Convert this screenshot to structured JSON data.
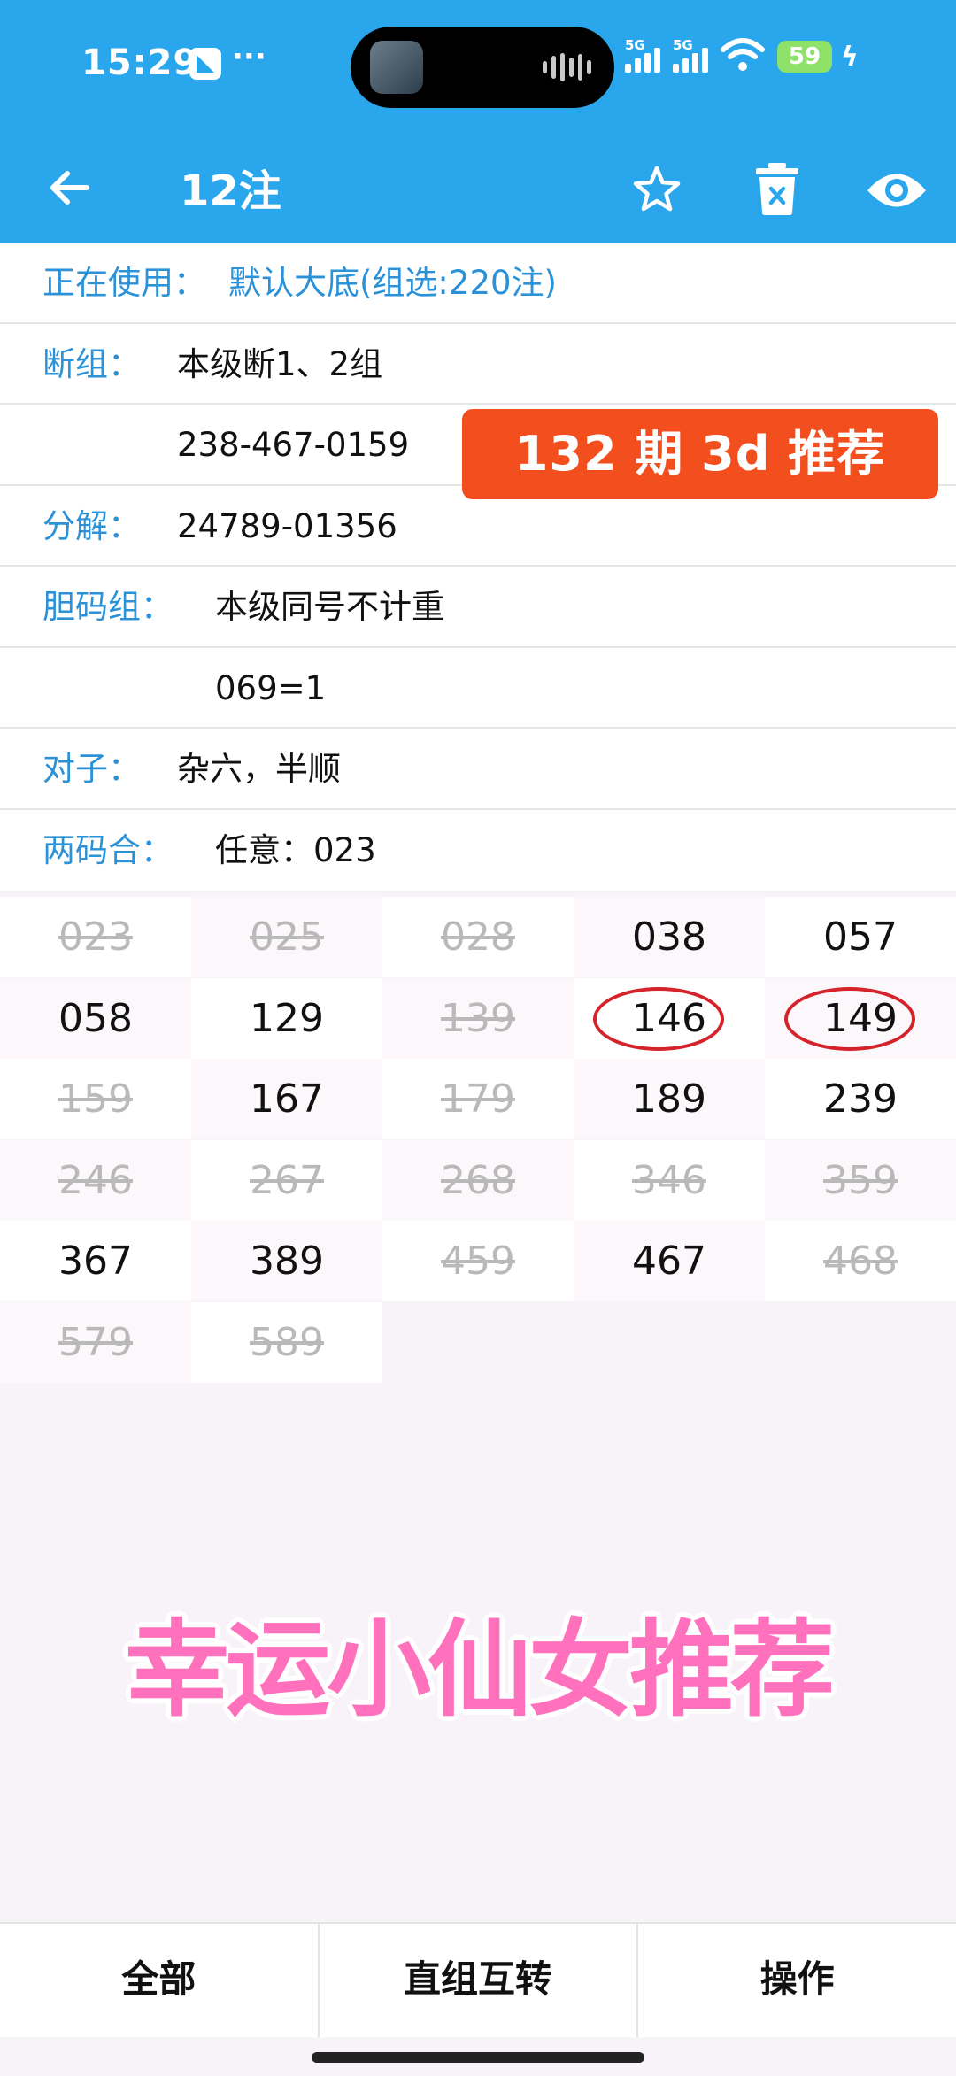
{
  "status_bar": {
    "time": "15:29",
    "dots": "···",
    "signal_1": "5G",
    "signal_2": "5G",
    "battery": "59"
  },
  "app_bar": {
    "title": "12注"
  },
  "info_rows": [
    {
      "label": "正在使用：",
      "value": "默认大底(组选:220注)"
    },
    {
      "label": "断组：",
      "value": "本级断1、2组"
    },
    {
      "label": "",
      "value": "238-467-0159"
    },
    {
      "label": "分解：",
      "value": "24789-01356"
    },
    {
      "label": "胆码组：",
      "value": "本级同号不计重"
    },
    {
      "label": "",
      "value": "069=1"
    },
    {
      "label": "对子：",
      "value": "杂六，半顺"
    },
    {
      "label": "两码合：",
      "value": "任意：023"
    }
  ],
  "promo_badge": "132 期 3d 推荐",
  "numbers": [
    {
      "value": "023",
      "struck": true
    },
    {
      "value": "025",
      "struck": true
    },
    {
      "value": "028",
      "struck": true
    },
    {
      "value": "038",
      "struck": false
    },
    {
      "value": "057",
      "struck": false
    },
    {
      "value": "058",
      "struck": false
    },
    {
      "value": "129",
      "struck": false
    },
    {
      "value": "139",
      "struck": true
    },
    {
      "value": "146",
      "struck": false,
      "circled": true
    },
    {
      "value": "149",
      "struck": false,
      "circled": true
    },
    {
      "value": "159",
      "struck": true
    },
    {
      "value": "167",
      "struck": false
    },
    {
      "value": "179",
      "struck": true
    },
    {
      "value": "189",
      "struck": false
    },
    {
      "value": "239",
      "struck": false
    },
    {
      "value": "246",
      "struck": true
    },
    {
      "value": "267",
      "struck": true
    },
    {
      "value": "268",
      "struck": true
    },
    {
      "value": "346",
      "struck": true
    },
    {
      "value": "359",
      "struck": true
    },
    {
      "value": "367",
      "struck": false
    },
    {
      "value": "389",
      "struck": false
    },
    {
      "value": "459",
      "struck": true
    },
    {
      "value": "467",
      "struck": false
    },
    {
      "value": "468",
      "struck": true
    },
    {
      "value": "579",
      "struck": true
    },
    {
      "value": "589",
      "struck": true
    }
  ],
  "caption": "幸运小仙女推荐",
  "bottom_bar": {
    "all": "全部",
    "convert": "直组互转",
    "actions": "操作"
  },
  "colors": {
    "primary": "#2aa6ec",
    "label": "#2c92d8",
    "badge": "#f24e1e",
    "circle": "#d4232a",
    "caption": "#ff70bd"
  },
  "icons": [
    "back-arrow-icon",
    "star-icon",
    "trash-icon",
    "eye-icon",
    "wifi-icon",
    "battery-icon"
  ]
}
